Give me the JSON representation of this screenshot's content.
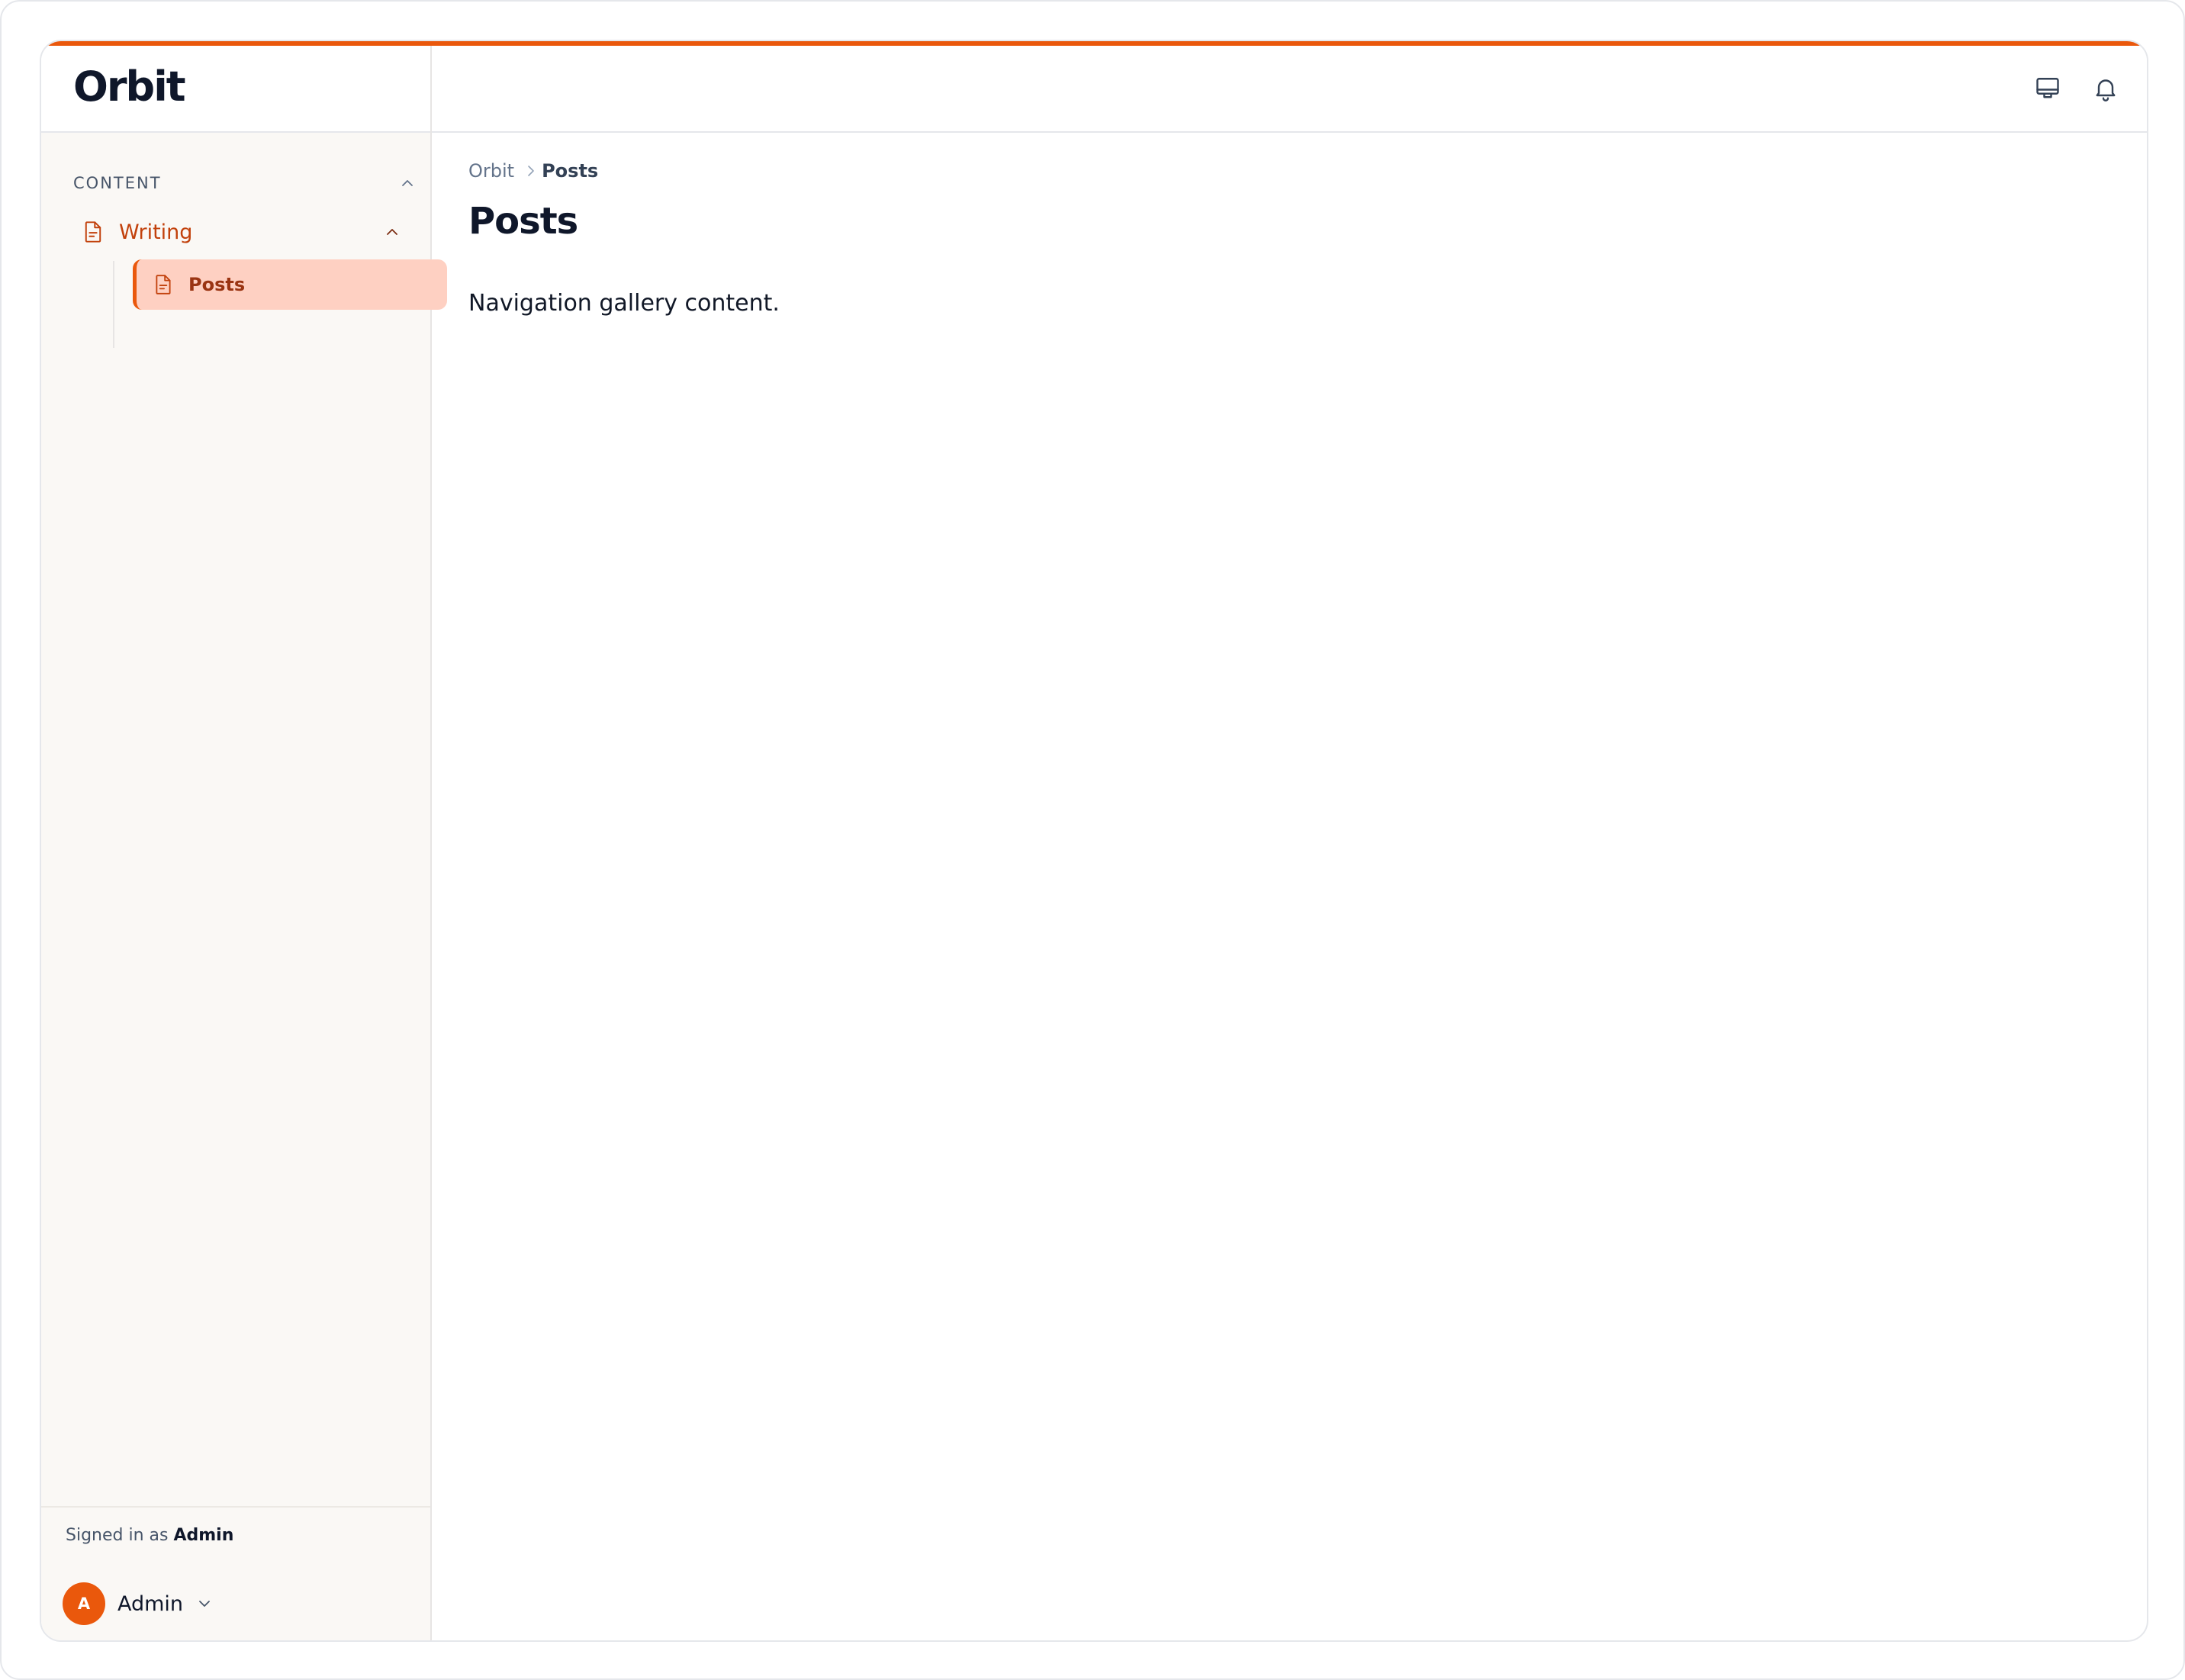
{
  "brand": {
    "name": "Orbit"
  },
  "sidebar": {
    "section_label": "CONTENT",
    "group": {
      "label": "Writing",
      "children": [
        {
          "label": "Posts",
          "active": true
        }
      ]
    },
    "footer": {
      "signed_in_prefix": "Signed in as",
      "signed_in_user": "Admin",
      "avatar_initial": "A",
      "user_name": "Admin"
    }
  },
  "topbar": {
    "icons": [
      "monitor-icon",
      "bell-icon"
    ]
  },
  "breadcrumb": {
    "root": "Orbit",
    "current": "Posts"
  },
  "page": {
    "title": "Posts",
    "body": "Navigation gallery content."
  },
  "colors": {
    "accent": "#ea580c",
    "active_bg": "#fed0c2",
    "active_text": "#9a3412",
    "group_text": "#c2410c"
  }
}
